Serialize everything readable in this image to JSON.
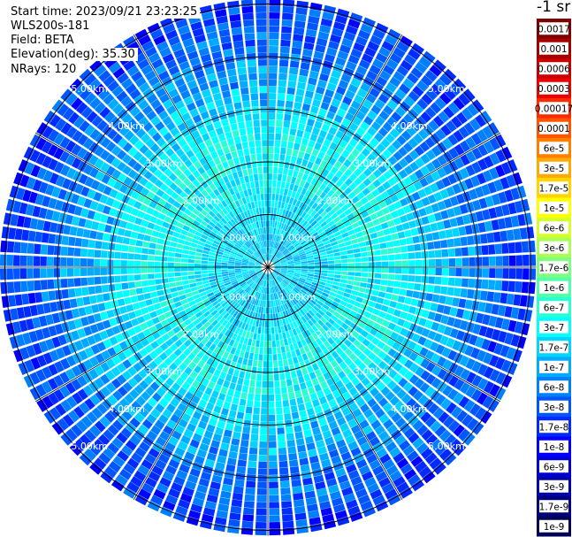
{
  "header": {
    "start_time": "Start time: 2023/09/21 23:23:25",
    "instrument": "WLS200s-181",
    "field": "Field: BETA",
    "elevation": "Elevation(deg): 35.30",
    "nrays": "NRays: 120"
  },
  "colorbar": {
    "unit": "-1 sr",
    "labels": [
      "0.0017",
      "0.001",
      "0.0006",
      "0.0003",
      "0.00017",
      "0.0001",
      "6e-5",
      "3e-5",
      "1.7e-5",
      "1e-5",
      "6e-6",
      "3e-6",
      "1.7e-6",
      "1e-6",
      "6e-7",
      "3e-7",
      "1.7e-7",
      "1e-7",
      "6e-8",
      "3e-8",
      "1.7e-8",
      "1e-8",
      "6e-9",
      "3e-9",
      "1.7e-9",
      "1e-9"
    ],
    "colors": [
      "#7f0000",
      "#a50000",
      "#c90000",
      "#ee0000",
      "#ff2a00",
      "#ff5500",
      "#ff7f00",
      "#ffaa00",
      "#ffd400",
      "#ffff00",
      "#d4ff2a",
      "#aaff55",
      "#7fff7f",
      "#55ffaa",
      "#2affd4",
      "#00ffff",
      "#00d4ff",
      "#00aaff",
      "#007fff",
      "#0055ff",
      "#002aff",
      "#0000ff",
      "#0000d4",
      "#0000aa",
      "#00007f",
      "#000055"
    ]
  },
  "chart_data": {
    "type": "heatmap",
    "projection": "polar (PPI scan)",
    "nrays": 120,
    "range_rings_km": [
      1,
      2,
      3,
      4,
      5
    ],
    "ring_labels": [
      "1.00km",
      "2.00km",
      "3.00km",
      "4.00km",
      "5.00km"
    ],
    "radial_lines_deg": [
      0,
      30,
      60,
      90,
      120,
      150,
      180,
      210,
      240,
      270,
      300,
      330
    ],
    "value_profile_by_range_km": [
      {
        "range": 0.5,
        "typical_value": "1.7e-7"
      },
      {
        "range": 1.0,
        "typical_value": "1.7e-7"
      },
      {
        "range": 1.5,
        "typical_value": "3e-7"
      },
      {
        "range": 2.5,
        "typical_value": "3e-7"
      },
      {
        "range": 3.5,
        "typical_value": "1e-7"
      },
      {
        "range": 4.5,
        "typical_value": "3e-8"
      },
      {
        "range": 5.2,
        "typical_value": "1.7e-8"
      }
    ]
  }
}
